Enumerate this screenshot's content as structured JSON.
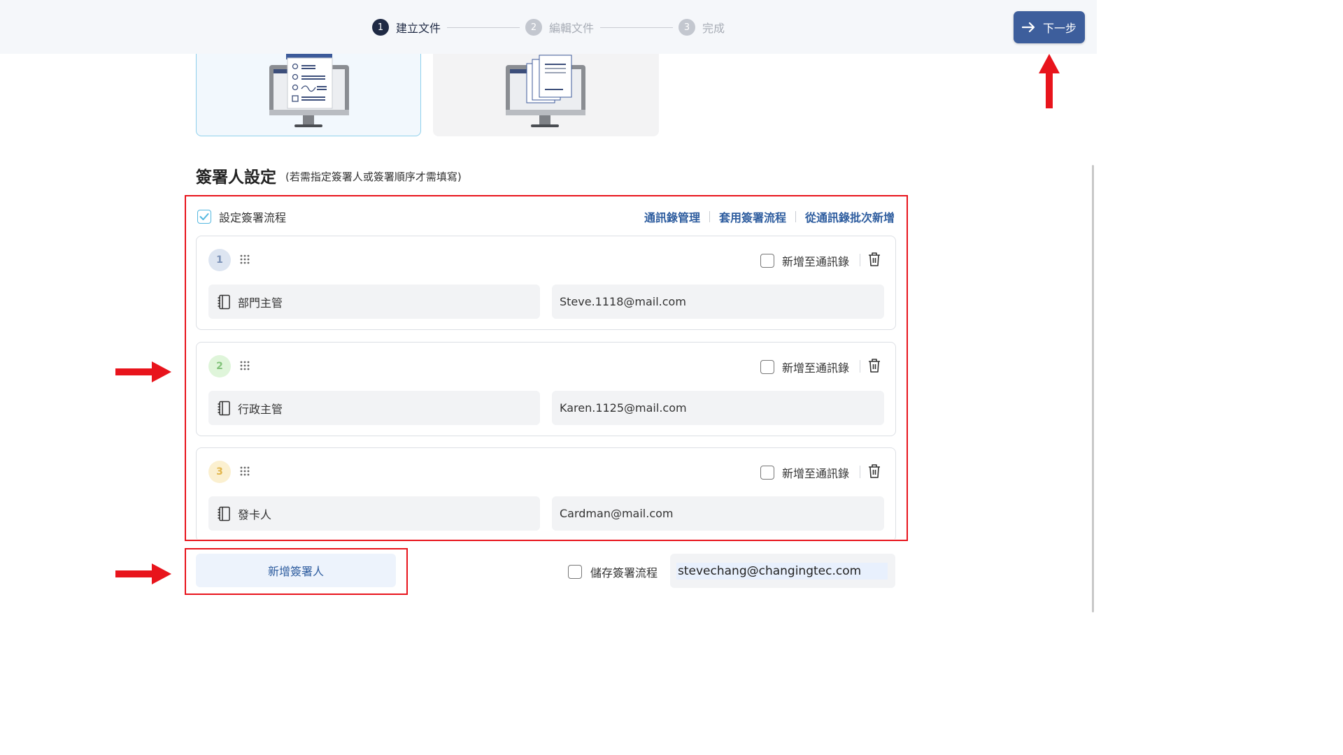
{
  "stepper": {
    "steps": [
      {
        "num": "1",
        "label": "建立文件"
      },
      {
        "num": "2",
        "label": "編輯文件"
      },
      {
        "num": "3",
        "label": "完成"
      }
    ],
    "next_label": "下一步"
  },
  "section": {
    "title": "簽署人設定",
    "subtitle": "(若需指定簽署人或簽署順序才需填寫)"
  },
  "flow": {
    "toggle_label": "設定簽署流程",
    "links": [
      "通訊錄管理",
      "套用簽署流程",
      "從通訊錄批次新增"
    ]
  },
  "signers": [
    {
      "order": "1",
      "role": "部門主管",
      "email": "Steve.1118@mail.com",
      "add_label": "新增至通訊錄",
      "badge_color": "#dde5f1",
      "badge_text_color": "#7d93b8"
    },
    {
      "order": "2",
      "role": "行政主管",
      "email": "Karen.1125@mail.com",
      "add_label": "新增至通訊錄",
      "badge_color": "#dff5da",
      "badge_text_color": "#82c37a"
    },
    {
      "order": "3",
      "role": "發卡人",
      "email": "Cardman@mail.com",
      "add_label": "新增至通訊錄",
      "badge_color": "#fbf0d0",
      "badge_text_color": "#e2b64d"
    }
  ],
  "bottom": {
    "add_signer_label": "新增簽署人",
    "save_flow_label": "儲存簽署流程",
    "owner_email": "stevechang@changingtec.com"
  },
  "colors": {
    "accent": "#3d5e9c",
    "link": "#2e5d9f",
    "annotation": "#e8141c"
  }
}
